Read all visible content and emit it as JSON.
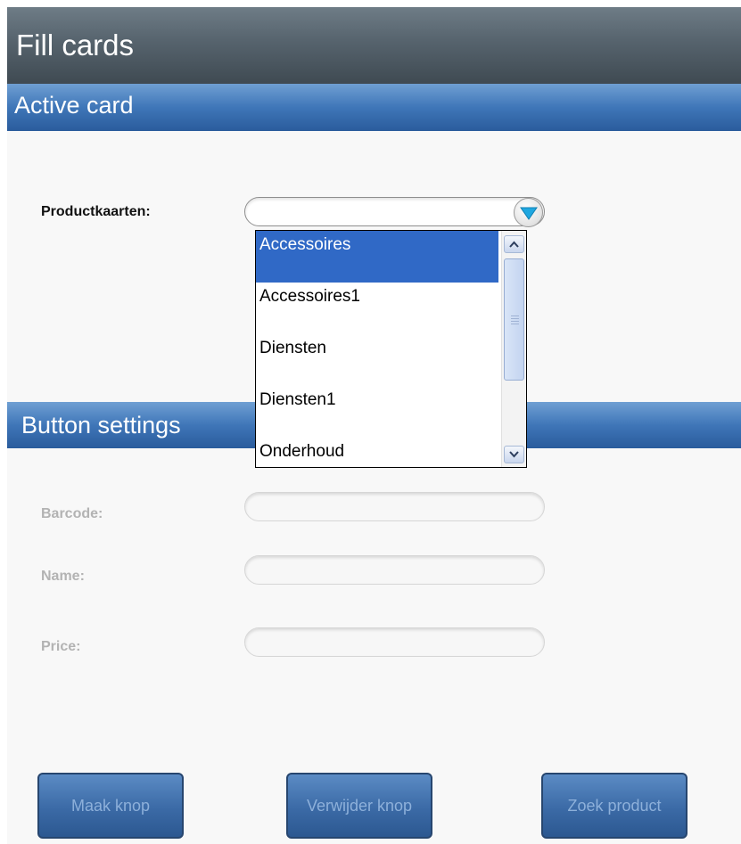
{
  "header": {
    "title": "Fill cards"
  },
  "active_card": {
    "section_title": "Active card",
    "productkaarten_label": "Productkaarten:",
    "productkaarten_value": "",
    "dropdown_options": [
      "Accessoires",
      "Accessoires1",
      "Diensten",
      "Diensten1",
      "Onderhoud"
    ],
    "selected_option": "Accessoires"
  },
  "button_settings": {
    "section_title": "Button settings",
    "barcode_label": "Barcode:",
    "barcode_value": "",
    "name_label": "Name:",
    "name_value": "",
    "price_label": "Price:",
    "price_value": ""
  },
  "actions": {
    "make_button": "Maak knop",
    "delete_button": "Verwijder knop",
    "search_button": "Zoek product"
  },
  "colors": {
    "header_gradient": "#56636d",
    "section_blue": "#3f76b8",
    "selected_blue": "#3069c6",
    "dropdown_arrow": "#1fa7e0"
  },
  "icons": {
    "dropdown": "chevron-down-icon",
    "scroll_up": "scroll-up-arrow-icon",
    "scroll_down": "scroll-down-arrow-icon"
  }
}
